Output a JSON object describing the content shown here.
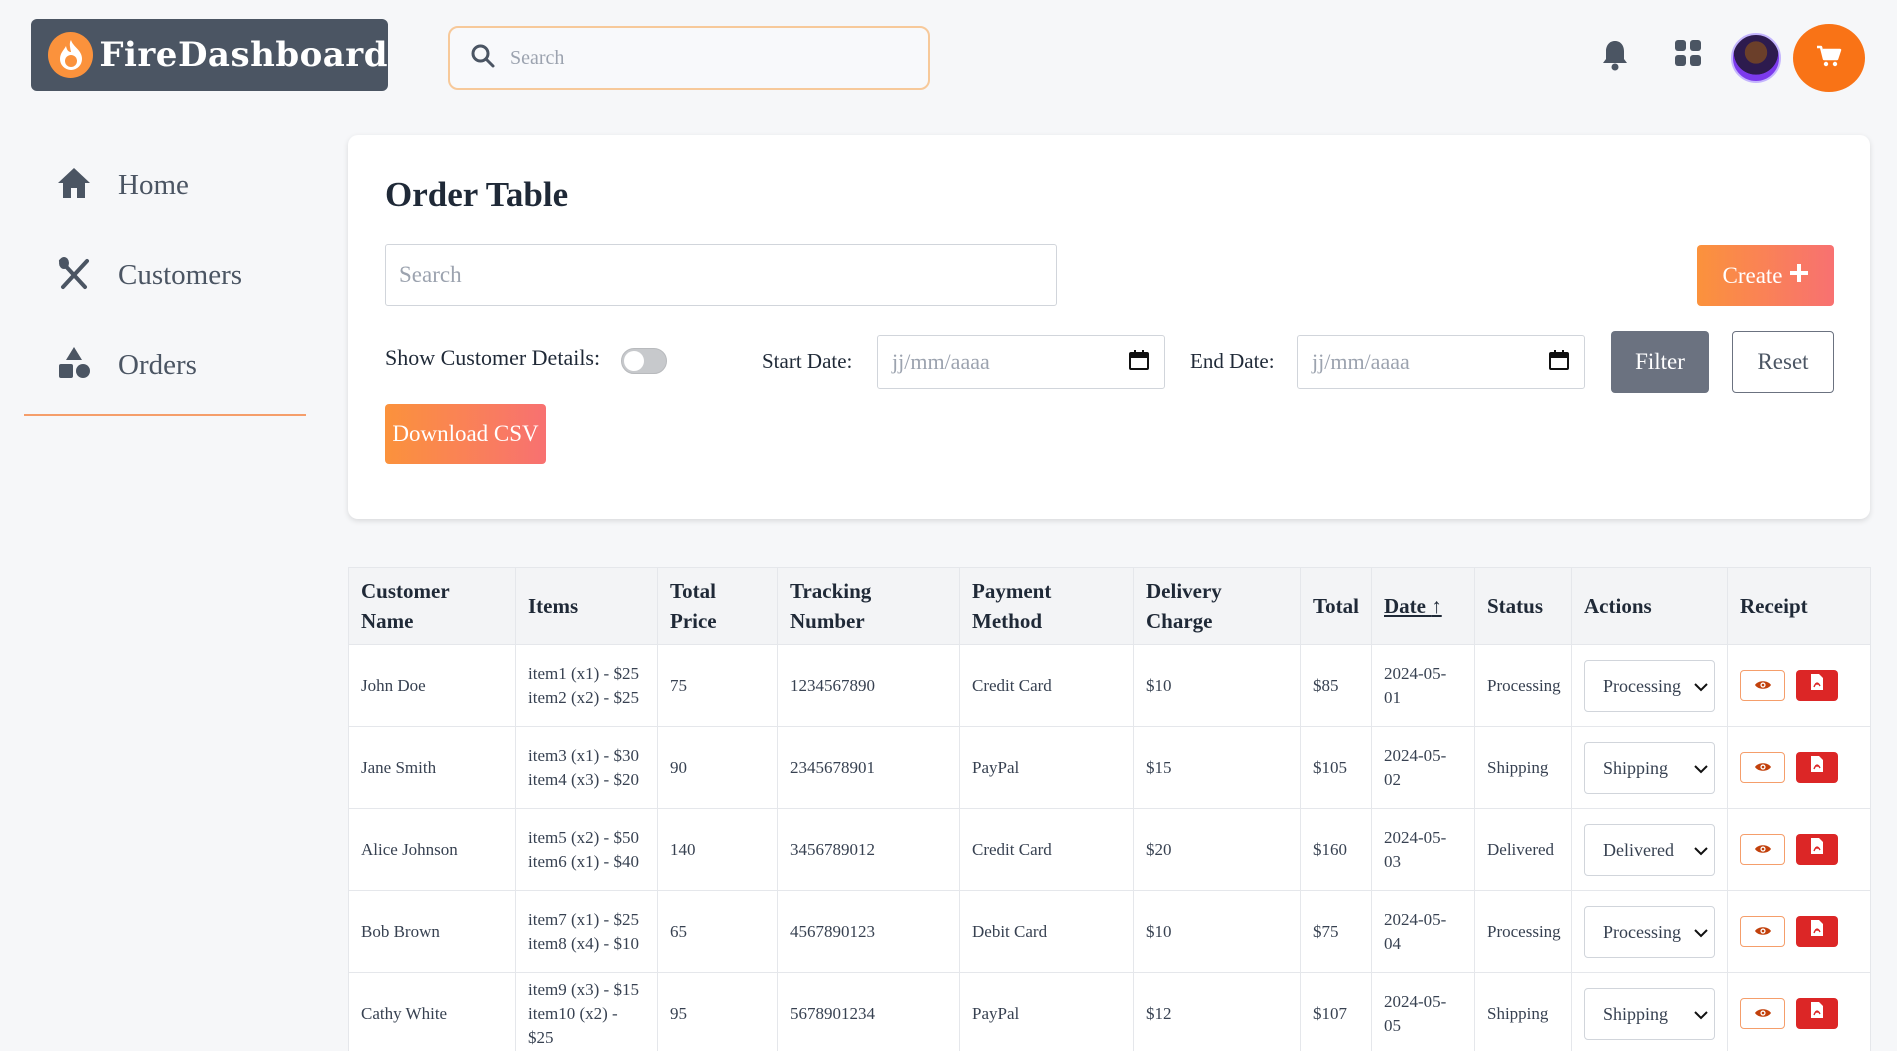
{
  "header": {
    "logo_text": "FireDashboard",
    "search_placeholder": "Search"
  },
  "sidebar": {
    "items": [
      {
        "label": "Home",
        "icon": "home-icon"
      },
      {
        "label": "Customers",
        "icon": "utensils-icon"
      },
      {
        "label": "Orders",
        "icon": "shapes-icon"
      }
    ]
  },
  "card": {
    "title": "Order Table",
    "search_placeholder": "Search",
    "create_label": "Create",
    "show_customer_label": "Show Customer Details:",
    "start_date_label": "Start Date:",
    "end_date_label": "End Date:",
    "date_placeholder": "jj/mm/aaaa",
    "filter_label": "Filter",
    "reset_label": "Reset",
    "csv_label": "Download CSV"
  },
  "table": {
    "headers": [
      "Customer Name",
      "Items",
      "Total Price",
      "Tracking Number",
      "Payment Method",
      "Delivery Charge",
      "Total",
      "Date",
      "Status",
      "Actions",
      "Receipt"
    ],
    "sort_arrow": "↑",
    "rows": [
      {
        "customer": "John Doe",
        "item1": "item1 (x1) - $25",
        "item2": "item2 (x2) - $25",
        "total_price": "75",
        "tracking": "1234567890",
        "payment": "Credit Card",
        "delivery": "$10",
        "total": "$85",
        "date": "2024-05-01",
        "status": "Processing",
        "action": "Processing"
      },
      {
        "customer": "Jane Smith",
        "item1": "item3 (x1) - $30",
        "item2": "item4 (x3) - $20",
        "total_price": "90",
        "tracking": "2345678901",
        "payment": "PayPal",
        "delivery": "$15",
        "total": "$105",
        "date": "2024-05-02",
        "status": "Shipping",
        "action": "Shipping"
      },
      {
        "customer": "Alice Johnson",
        "item1": "item5 (x2) - $50",
        "item2": "item6 (x1) - $40",
        "total_price": "140",
        "tracking": "3456789012",
        "payment": "Credit Card",
        "delivery": "$20",
        "total": "$160",
        "date": "2024-05-03",
        "status": "Delivered",
        "action": "Delivered"
      },
      {
        "customer": "Bob Brown",
        "item1": "item7 (x1) - $25",
        "item2": "item8 (x4) - $10",
        "total_price": "65",
        "tracking": "4567890123",
        "payment": "Debit Card",
        "delivery": "$10",
        "total": "$75",
        "date": "2024-05-04",
        "status": "Processing",
        "action": "Processing"
      },
      {
        "customer": "Cathy White",
        "item1": "item9 (x3) - $15",
        "item2": "item10 (x2) - $25",
        "total_price": "95",
        "tracking": "5678901234",
        "payment": "PayPal",
        "delivery": "$12",
        "total": "$107",
        "date": "2024-05-05",
        "status": "Shipping",
        "action": "Shipping"
      }
    ]
  },
  "colors": {
    "accent": "#f97316",
    "logo_bg": "#4b5563",
    "pdf_red": "#dc2626",
    "filter_gray": "#6b7280"
  }
}
